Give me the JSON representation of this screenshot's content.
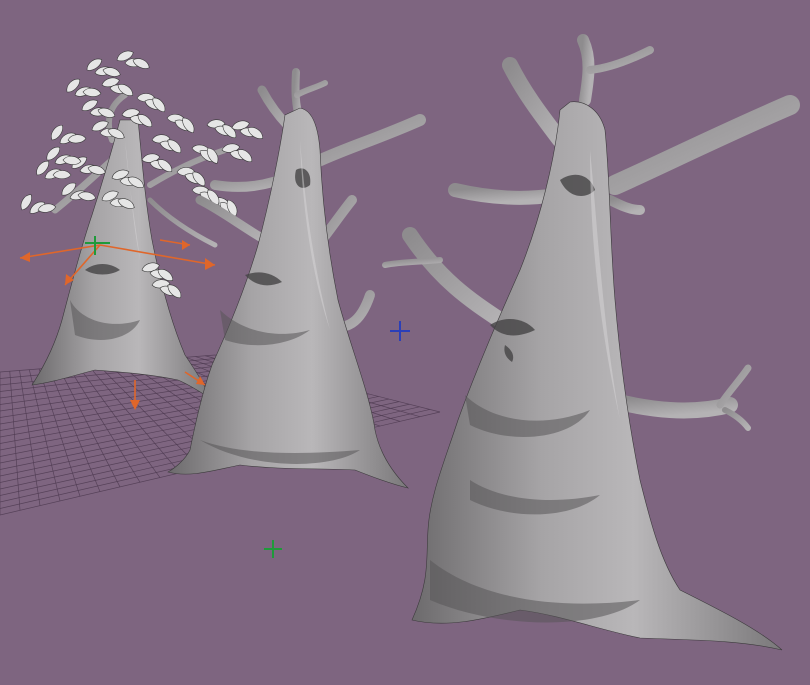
{
  "viewport": {
    "background_color": "#7e6580",
    "grid_color": "#4f3b52",
    "model_color": "#9a989a",
    "gizmo_color": "#e0662a",
    "selection_axis_color": "#1f9a3a"
  },
  "scene": {
    "objects": [
      {
        "name": "tree-with-leaves",
        "selected": true
      },
      {
        "name": "tree-face-middle",
        "selected": false
      },
      {
        "name": "tree-face-front",
        "selected": false
      }
    ],
    "markers": [
      {
        "name": "light-marker-blue",
        "color": "#2b3fb8"
      },
      {
        "name": "light-marker-green",
        "color": "#1f9a3a"
      }
    ]
  }
}
